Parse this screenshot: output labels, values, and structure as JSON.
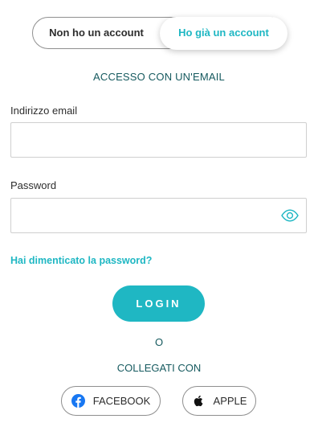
{
  "toggle": {
    "left_label": "Non ho un account",
    "right_label": "Ho già un account",
    "selected": "Ho già un account"
  },
  "section_title": "ACCESSO CON UN'EMAIL",
  "email": {
    "label": "Indirizzo email",
    "value": "",
    "placeholder": ""
  },
  "password": {
    "label": "Password",
    "value": "",
    "placeholder": "",
    "toggle_icon": "eye-icon"
  },
  "forgot_password": "Hai dimenticato la password?",
  "login_button": "LOGIN",
  "or_text": "O",
  "connect_with": "COLLEGATI CON",
  "social": {
    "facebook": {
      "label": "FACEBOOK",
      "icon": "facebook-icon"
    },
    "apple": {
      "label": "APPLE",
      "icon": "apple-icon"
    }
  },
  "colors": {
    "accent": "#1fb7c3",
    "dark_teal_text": "#165a5f",
    "facebook_blue": "#1877f2"
  }
}
